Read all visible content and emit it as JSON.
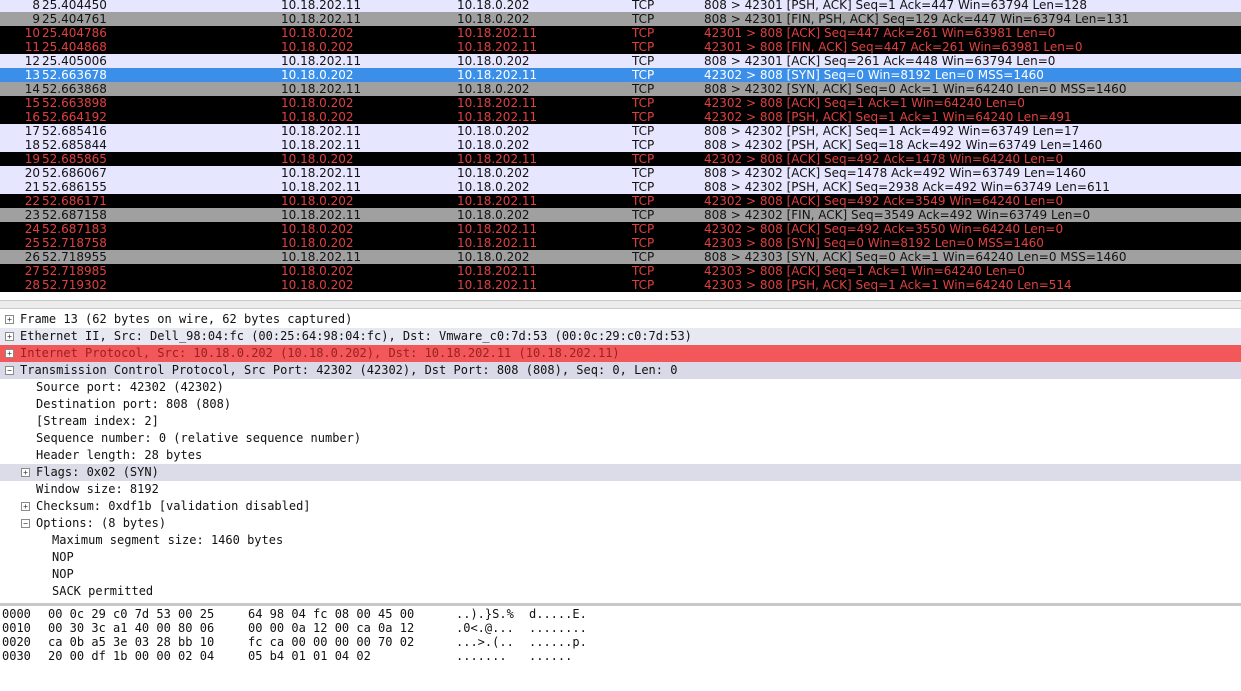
{
  "packets": [
    {
      "no": "8",
      "time": "25.404450",
      "src": "10.18.202.11",
      "dst": "10.18.0.202",
      "proto": "TCP",
      "info": "808 > 42301 [PSH, ACK] Seq=1 Ack=447 Win=63794 Len=128",
      "style": "normal"
    },
    {
      "no": "9",
      "time": "25.404761",
      "src": "10.18.202.11",
      "dst": "10.18.0.202",
      "proto": "TCP",
      "info": "808 > 42301 [FIN, PSH, ACK] Seq=129 Ack=447 Win=63794 Len=131",
      "style": "gray"
    },
    {
      "no": "10",
      "time": "25.404786",
      "src": "10.18.0.202",
      "dst": "10.18.202.11",
      "proto": "TCP",
      "info": "42301 > 808 [ACK] Seq=447 Ack=261 Win=63981 Len=0",
      "style": "dark"
    },
    {
      "no": "11",
      "time": "25.404868",
      "src": "10.18.0.202",
      "dst": "10.18.202.11",
      "proto": "TCP",
      "info": "42301 > 808 [FIN, ACK] Seq=447 Ack=261 Win=63981 Len=0",
      "style": "dark"
    },
    {
      "no": "12",
      "time": "25.405006",
      "src": "10.18.202.11",
      "dst": "10.18.0.202",
      "proto": "TCP",
      "info": "808 > 42301 [ACK] Seq=261 Ack=448 Win=63794 Len=0",
      "style": "normal"
    },
    {
      "no": "13",
      "time": "52.663678",
      "src": "10.18.0.202",
      "dst": "10.18.202.11",
      "proto": "TCP",
      "info": "42302 > 808 [SYN] Seq=0 Win=8192 Len=0 MSS=1460",
      "style": "sel"
    },
    {
      "no": "14",
      "time": "52.663868",
      "src": "10.18.202.11",
      "dst": "10.18.0.202",
      "proto": "TCP",
      "info": "808 > 42302 [SYN, ACK] Seq=0 Ack=1 Win=64240 Len=0 MSS=1460",
      "style": "gray"
    },
    {
      "no": "15",
      "time": "52.663898",
      "src": "10.18.0.202",
      "dst": "10.18.202.11",
      "proto": "TCP",
      "info": "42302 > 808 [ACK] Seq=1 Ack=1 Win=64240 Len=0",
      "style": "dark"
    },
    {
      "no": "16",
      "time": "52.664192",
      "src": "10.18.0.202",
      "dst": "10.18.202.11",
      "proto": "TCP",
      "info": "42302 > 808 [PSH, ACK] Seq=1 Ack=1 Win=64240 Len=491",
      "style": "dark"
    },
    {
      "no": "17",
      "time": "52.685416",
      "src": "10.18.202.11",
      "dst": "10.18.0.202",
      "proto": "TCP",
      "info": "808 > 42302 [PSH, ACK] Seq=1 Ack=492 Win=63749 Len=17",
      "style": "normal"
    },
    {
      "no": "18",
      "time": "52.685844",
      "src": "10.18.202.11",
      "dst": "10.18.0.202",
      "proto": "TCP",
      "info": "808 > 42302 [PSH, ACK] Seq=18 Ack=492 Win=63749 Len=1460",
      "style": "normal"
    },
    {
      "no": "19",
      "time": "52.685865",
      "src": "10.18.0.202",
      "dst": "10.18.202.11",
      "proto": "TCP",
      "info": "42302 > 808 [ACK] Seq=492 Ack=1478 Win=64240 Len=0",
      "style": "dark"
    },
    {
      "no": "20",
      "time": "52.686067",
      "src": "10.18.202.11",
      "dst": "10.18.0.202",
      "proto": "TCP",
      "info": "808 > 42302 [ACK] Seq=1478 Ack=492 Win=63749 Len=1460",
      "style": "normal"
    },
    {
      "no": "21",
      "time": "52.686155",
      "src": "10.18.202.11",
      "dst": "10.18.0.202",
      "proto": "TCP",
      "info": "808 > 42302 [PSH, ACK] Seq=2938 Ack=492 Win=63749 Len=611",
      "style": "normal"
    },
    {
      "no": "22",
      "time": "52.686171",
      "src": "10.18.0.202",
      "dst": "10.18.202.11",
      "proto": "TCP",
      "info": "42302 > 808 [ACK] Seq=492 Ack=3549 Win=64240 Len=0",
      "style": "dark"
    },
    {
      "no": "23",
      "time": "52.687158",
      "src": "10.18.202.11",
      "dst": "10.18.0.202",
      "proto": "TCP",
      "info": "808 > 42302 [FIN, ACK] Seq=3549 Ack=492 Win=63749 Len=0",
      "style": "gray"
    },
    {
      "no": "24",
      "time": "52.687183",
      "src": "10.18.0.202",
      "dst": "10.18.202.11",
      "proto": "TCP",
      "info": "42302 > 808 [ACK] Seq=492 Ack=3550 Win=64240 Len=0",
      "style": "dark"
    },
    {
      "no": "25",
      "time": "52.718758",
      "src": "10.18.0.202",
      "dst": "10.18.202.11",
      "proto": "TCP",
      "info": "42303 > 808 [SYN] Seq=0 Win=8192 Len=0 MSS=1460",
      "style": "dark"
    },
    {
      "no": "26",
      "time": "52.718955",
      "src": "10.18.202.11",
      "dst": "10.18.0.202",
      "proto": "TCP",
      "info": "808 > 42303 [SYN, ACK] Seq=0 Ack=1 Win=64240 Len=0 MSS=1460",
      "style": "gray"
    },
    {
      "no": "27",
      "time": "52.718985",
      "src": "10.18.0.202",
      "dst": "10.18.202.11",
      "proto": "TCP",
      "info": "42303 > 808 [ACK] Seq=1 Ack=1 Win=64240 Len=0",
      "style": "dark"
    },
    {
      "no": "28",
      "time": "52.719302",
      "src": "10.18.0.202",
      "dst": "10.18.202.11",
      "proto": "TCP",
      "info": "42303 > 808 [PSH, ACK] Seq=1 Ack=1 Win=64240 Len=514",
      "style": "dark"
    }
  ],
  "details": [
    {
      "indent": 0,
      "expander": "plus",
      "text": "Frame 13 (62 bytes on wire, 62 bytes captured)",
      "style": "none"
    },
    {
      "indent": 0,
      "expander": "plus",
      "text": "Ethernet II, Src: Dell_98:04:fc (00:25:64:98:04:fc), Dst: Vmware_c0:7d:53 (00:0c:29:c0:7d:53)",
      "style": "eth"
    },
    {
      "indent": 0,
      "expander": "plus",
      "text": "Internet Protocol, Src: 10.18.0.202 (10.18.0.202), Dst: 10.18.202.11 (10.18.202.11)",
      "style": "ip"
    },
    {
      "indent": 0,
      "expander": "minus",
      "text": "Transmission Control Protocol, Src Port: 42302 (42302), Dst Port: 808 (808), Seq: 0, Len: 0",
      "style": "tcp"
    },
    {
      "indent": 1,
      "expander": "none",
      "text": "Source port: 42302 (42302)",
      "style": "none"
    },
    {
      "indent": 1,
      "expander": "none",
      "text": "Destination port: 808 (808)",
      "style": "none"
    },
    {
      "indent": 1,
      "expander": "none",
      "text": "[Stream index: 2]",
      "style": "none"
    },
    {
      "indent": 1,
      "expander": "none",
      "text": "Sequence number: 0    (relative sequence number)",
      "style": "none"
    },
    {
      "indent": 1,
      "expander": "none",
      "text": "Header length: 28 bytes",
      "style": "none"
    },
    {
      "indent": 1,
      "expander": "plus",
      "text": "Flags: 0x02 (SYN)",
      "style": "flags"
    },
    {
      "indent": 1,
      "expander": "none",
      "text": "Window size: 8192",
      "style": "none"
    },
    {
      "indent": 1,
      "expander": "plus",
      "text": "Checksum: 0xdf1b [validation disabled]",
      "style": "none"
    },
    {
      "indent": 1,
      "expander": "minus",
      "text": "Options: (8 bytes)",
      "style": "none"
    },
    {
      "indent": 2,
      "expander": "none",
      "text": "Maximum segment size: 1460 bytes",
      "style": "none"
    },
    {
      "indent": 2,
      "expander": "none",
      "text": "NOP",
      "style": "none"
    },
    {
      "indent": 2,
      "expander": "none",
      "text": "NOP",
      "style": "none"
    },
    {
      "indent": 2,
      "expander": "none",
      "text": "SACK permitted",
      "style": "none"
    }
  ],
  "hexdump": [
    {
      "offset": "0000",
      "bytes1": "00 0c 29 c0 7d 53 00 25",
      "bytes2": "64 98 04 fc 08 00 45 00",
      "ascii1": "..).}S.%",
      "ascii2": "d.....E."
    },
    {
      "offset": "0010",
      "bytes1": "00 30 3c a1 40 00 80 06",
      "bytes2": "00 00 0a 12 00 ca 0a 12",
      "ascii1": ".0<.@...",
      "ascii2": "........"
    },
    {
      "offset": "0020",
      "bytes1": "ca 0b a5 3e 03 28 bb 10",
      "bytes2": "fc ca 00 00 00 00 70 02",
      "ascii1": "...>.(..",
      "ascii2": "......p."
    },
    {
      "offset": "0030",
      "bytes1": "20 00 df 1b 00 00 02 04",
      "bytes2": "05 b4 01 01 04 02",
      "ascii1": " .......",
      "ascii2": "......"
    }
  ],
  "expander_glyphs": {
    "plus": "+",
    "minus": "−"
  }
}
